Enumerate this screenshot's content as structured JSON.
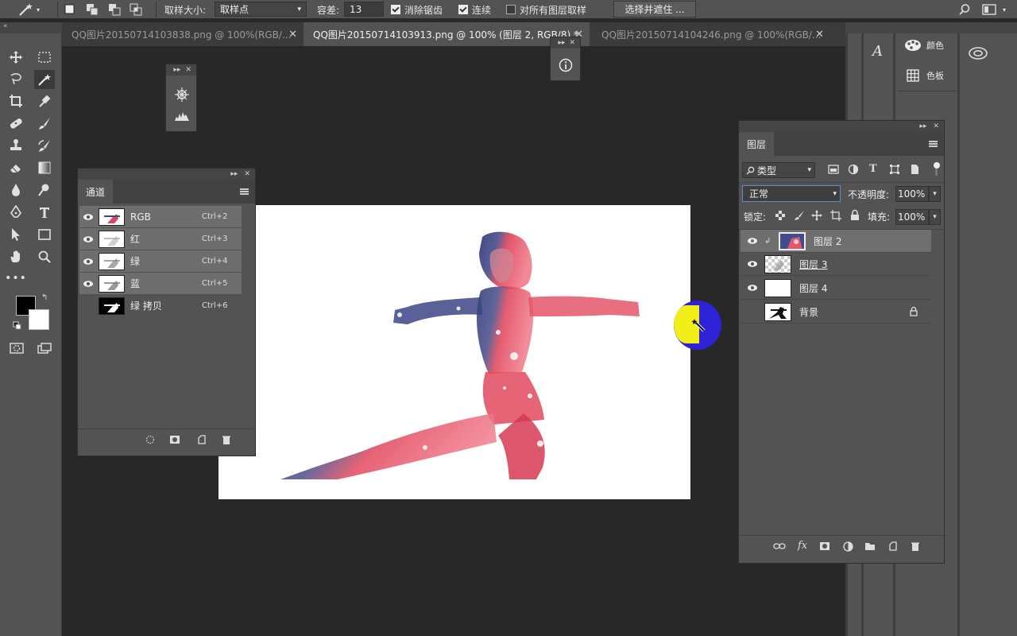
{
  "options_bar": {
    "sample_size_label": "取样大小:",
    "sample_size_value": "取样点",
    "tolerance_label": "容差:",
    "tolerance_value": "13",
    "antialias_label": "消除锯齿",
    "antialias_checked": true,
    "contiguous_label": "连续",
    "contiguous_checked": true,
    "all_layers_label": "对所有图层取样",
    "all_layers_checked": false,
    "select_mask_label": "选择并遮住 ..."
  },
  "tabs": [
    {
      "label": "QQ图片20150714103838.png @ 100%(RGB/...",
      "active": false
    },
    {
      "label": "QQ图片20150714103913.png @ 100% (图层 2, RGB/8) * ",
      "active": true
    },
    {
      "label": "QQ图片20150714104246.png @ 100%(RGB/...",
      "active": false
    }
  ],
  "channels_panel": {
    "title": "通道",
    "rows": [
      {
        "name": "RGB",
        "shortcut": "Ctrl+2",
        "visible": true,
        "selected": true
      },
      {
        "name": "红",
        "shortcut": "Ctrl+3",
        "visible": true,
        "selected": true
      },
      {
        "name": "绿",
        "shortcut": "Ctrl+4",
        "visible": true,
        "selected": true
      },
      {
        "name": "蓝",
        "shortcut": "Ctrl+5",
        "visible": true,
        "selected": true
      },
      {
        "name": "绿 拷贝",
        "shortcut": "Ctrl+6",
        "visible": false,
        "selected": false
      }
    ]
  },
  "layers_panel": {
    "title": "图层",
    "filter_kind": "类型",
    "blend_mode": "正常",
    "opacity_label": "不透明度:",
    "opacity_value": "100%",
    "lock_label": "锁定:",
    "fill_label": "填充:",
    "fill_value": "100%",
    "layers": [
      {
        "name": "图层 2",
        "visible": true,
        "selected": true,
        "clipped": true
      },
      {
        "name": "图层 3",
        "visible": true,
        "selected": false
      },
      {
        "name": "图层 4",
        "visible": true,
        "selected": false
      },
      {
        "name": "背景",
        "visible": false,
        "selected": false,
        "locked": true
      }
    ]
  },
  "dock": {
    "color_label": "颜色",
    "swatches_label": "色板"
  },
  "colors": {
    "foreground": "#000000",
    "background": "#ffffff",
    "cursor_ring": "#2d22d6",
    "cursor_core": "#f2ee1a"
  }
}
